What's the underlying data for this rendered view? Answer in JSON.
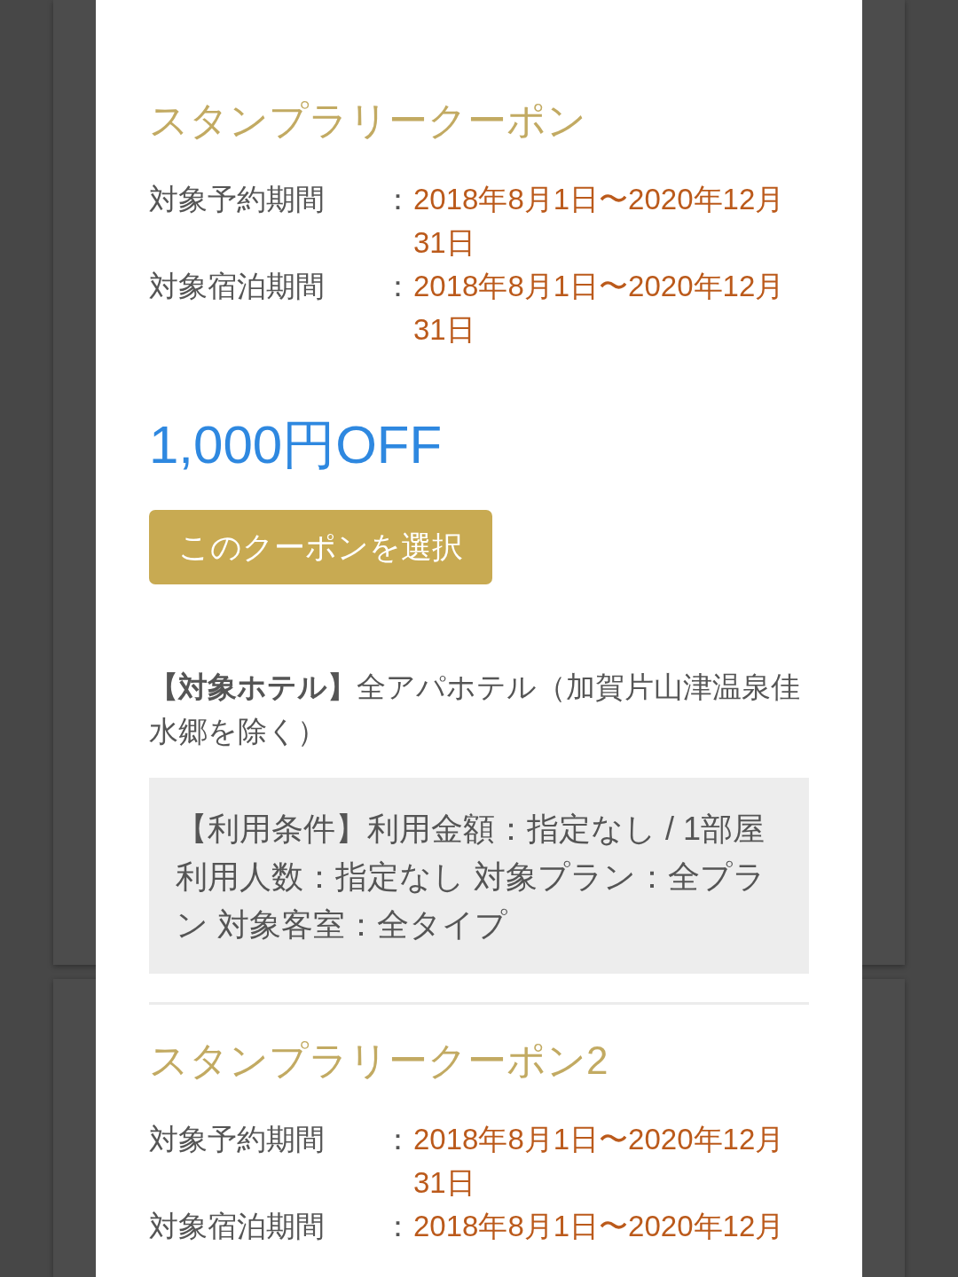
{
  "modal": {
    "coupons": [
      {
        "title": "スタンプラリークーポン",
        "periods": [
          {
            "label": "対象予約期間",
            "separator": "：",
            "value": "2018年8月1日〜2020年12月31日"
          },
          {
            "label": "対象宿泊期間",
            "separator": "：",
            "value": "2018年8月1日〜2020年12月31日"
          }
        ],
        "discount": "1,000円OFF",
        "select_button": "このクーポンを選択",
        "target_hotels": "**【対象ホテル】**全アパホテル（加賀片山津温泉佳水郷を除く）",
        "conditions": "【利用条件】利用金額：指定なし / 1部屋利用人数：指定なし 対象プラン：全プラン 対象客室：全タイプ"
      },
      {
        "title": "スタンプラリークーポン2",
        "periods": [
          {
            "label": "対象予約期間",
            "separator": "：",
            "value": "2018年8月1日〜2020年12月31日"
          },
          {
            "label": "対象宿泊期間",
            "separator": "：",
            "value": "2018年8月1日〜2020年12月"
          }
        ]
      }
    ]
  }
}
